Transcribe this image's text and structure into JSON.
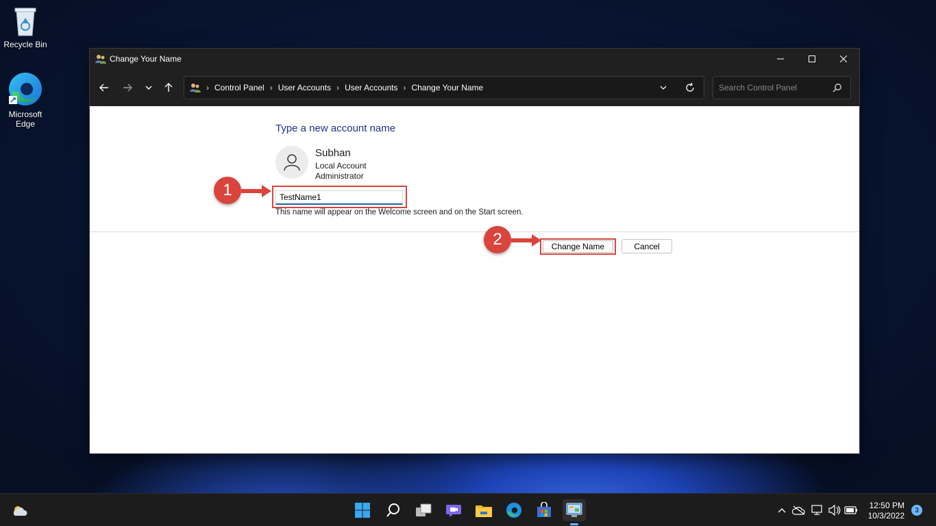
{
  "desktop": {
    "recycle_bin_label": "Recycle Bin",
    "edge_label_line1": "Microsoft",
    "edge_label_line2": "Edge"
  },
  "window": {
    "title": "Change Your Name",
    "breadcrumbs": [
      "Control Panel",
      "User Accounts",
      "User Accounts",
      "Change Your Name"
    ],
    "search_placeholder": "Search Control Panel"
  },
  "content": {
    "heading": "Type a new account name",
    "user": {
      "name": "Subhan",
      "account_type": "Local Account",
      "role": "Administrator"
    },
    "name_input_value": "TestName1",
    "hint": "This name will appear on the Welcome screen and on the Start screen.",
    "change_button": "Change Name",
    "cancel_button": "Cancel"
  },
  "annotations": {
    "step1": "1",
    "step2": "2",
    "color": "#d9443c"
  },
  "taskbar": {
    "time": "12:50 PM",
    "date": "10/3/2022",
    "notification_count": "3"
  },
  "colors": {
    "heading": "#1e3287",
    "accent": "#6cb6ff",
    "titlebar": "#202020"
  }
}
